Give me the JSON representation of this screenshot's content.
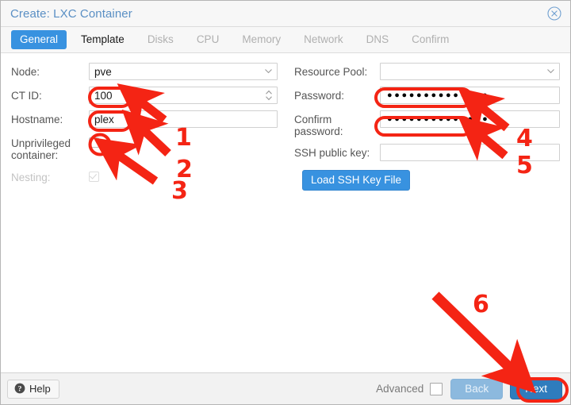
{
  "window": {
    "title": "Create: LXC Container",
    "close_icon": "close-circle-icon"
  },
  "tabs": [
    {
      "label": "General",
      "state": "active"
    },
    {
      "label": "Template",
      "state": "enabled"
    },
    {
      "label": "Disks",
      "state": "disabled"
    },
    {
      "label": "CPU",
      "state": "disabled"
    },
    {
      "label": "Memory",
      "state": "disabled"
    },
    {
      "label": "Network",
      "state": "disabled"
    },
    {
      "label": "DNS",
      "state": "disabled"
    },
    {
      "label": "Confirm",
      "state": "disabled"
    }
  ],
  "form": {
    "left": {
      "node": {
        "label": "Node:",
        "value": "pve",
        "icon": "chevron-down-icon"
      },
      "ct_id": {
        "label": "CT ID:",
        "value": "100",
        "icon": "spinner-arrows-icon"
      },
      "hostname": {
        "label": "Hostname:",
        "value": "plex",
        "placeholder": ""
      },
      "unprivileged": {
        "label": "Unprivileged container:",
        "checked": false
      },
      "nesting": {
        "label": "Nesting:",
        "checked": true,
        "disabled": true
      }
    },
    "right": {
      "resource_pool": {
        "label": "Resource Pool:",
        "value": "",
        "icon": "chevron-down-icon"
      },
      "password": {
        "label": "Password:",
        "value": "●●●●●●●●●●●●●●"
      },
      "confirm_password": {
        "label": "Confirm password:",
        "value": "●●●●●●●●●●●●●●"
      },
      "ssh_public_key": {
        "label": "SSH public key:",
        "value": ""
      },
      "load_ssh_button": "Load SSH Key File"
    }
  },
  "footer": {
    "help": "Help",
    "help_icon": "question-circle-icon",
    "advanced_label": "Advanced",
    "advanced_checked": false,
    "back": "Back",
    "next": "Next"
  },
  "annotations": {
    "color": "#f42414",
    "numbers": [
      {
        "text": "1",
        "target": "ct-id-field"
      },
      {
        "text": "2",
        "target": "hostname-field"
      },
      {
        "text": "3",
        "target": "unprivileged-checkbox"
      },
      {
        "text": "4",
        "target": "password-field"
      },
      {
        "text": "5",
        "target": "confirm-password-field"
      },
      {
        "text": "6",
        "target": "next-button"
      }
    ],
    "highlight_shapes": [
      {
        "shape": "ellipse",
        "target": "ct-id-field"
      },
      {
        "shape": "ellipse",
        "target": "hostname-field"
      },
      {
        "shape": "circle",
        "target": "unprivileged-checkbox"
      },
      {
        "shape": "ellipse",
        "target": "password-field"
      },
      {
        "shape": "ellipse",
        "target": "confirm-password-field"
      },
      {
        "shape": "ellipse",
        "target": "next-button"
      }
    ]
  }
}
